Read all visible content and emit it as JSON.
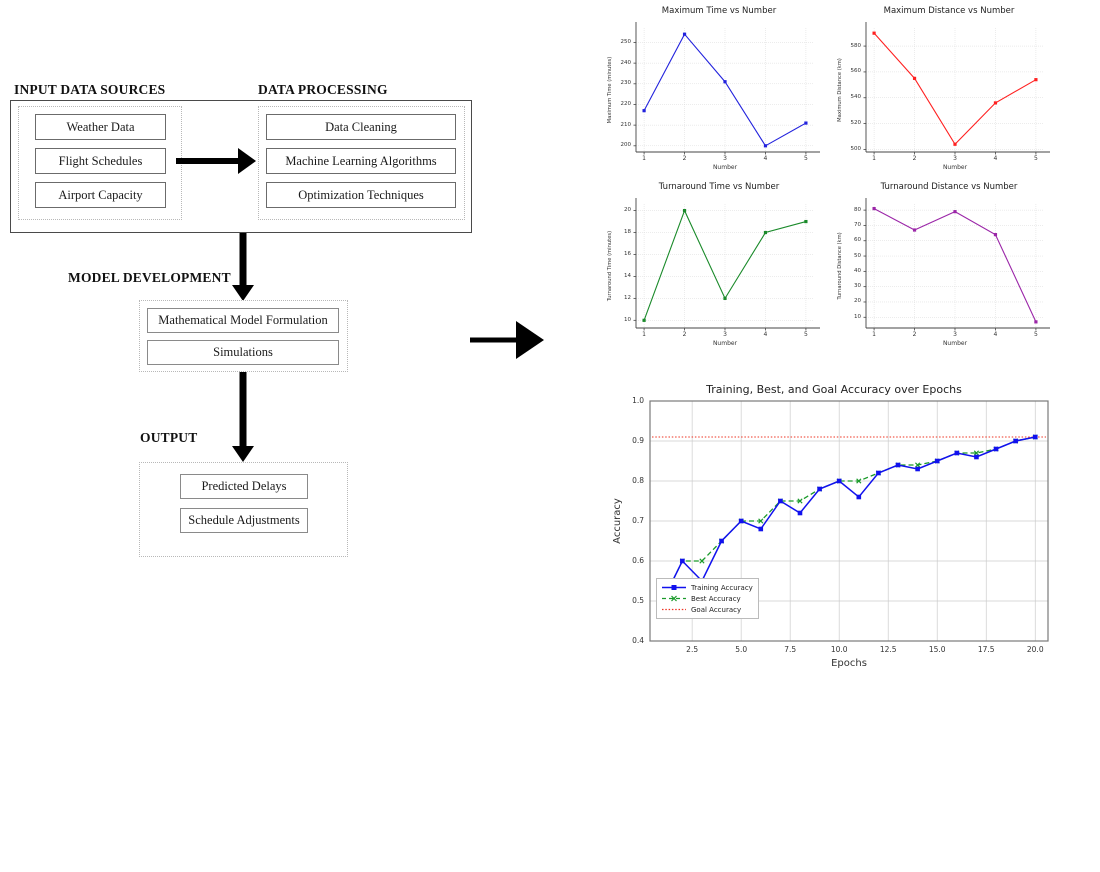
{
  "flowchart": {
    "headings": {
      "input": "INPUT DATA SOURCES",
      "processing": "DATA PROCESSING",
      "model": "MODEL DEVELOPMENT",
      "output": "OUTPUT"
    },
    "input_items": [
      "Weather Data",
      "Flight Schedules",
      "Airport Capacity"
    ],
    "processing_items": [
      "Data Cleaning",
      "Machine Learning Algorithms",
      "Optimization Techniques"
    ],
    "model_items": [
      "Mathematical Model Formulation",
      "Simulations"
    ],
    "output_items": [
      "Predicted Delays",
      "Schedule Adjustments"
    ]
  },
  "chart_data": [
    {
      "type": "line",
      "title": "Maximum Time vs Number",
      "xlabel": "Number",
      "ylabel": "Maximum Time (minutes)",
      "x": [
        1,
        2,
        3,
        4,
        5
      ],
      "values": [
        217,
        254,
        231,
        200,
        211
      ],
      "xticks": [
        "1",
        "2",
        "3",
        "4",
        "5"
      ],
      "yticks": [
        "200",
        "210",
        "220",
        "230",
        "240",
        "250"
      ],
      "xlim": [
        0.8,
        5.2
      ],
      "ylim": [
        197,
        257
      ],
      "color": "#2222dd",
      "grid": true,
      "legend": "none"
    },
    {
      "type": "line",
      "title": "Maximum Distance vs Number",
      "xlabel": "Number",
      "ylabel": "Maximum Distance (km)",
      "x": [
        1,
        2,
        3,
        4,
        5
      ],
      "values": [
        590,
        555,
        504,
        536,
        554
      ],
      "xticks": [
        "1",
        "2",
        "3",
        "4",
        "5"
      ],
      "yticks": [
        "500",
        "520",
        "540",
        "560",
        "580"
      ],
      "xlim": [
        0.8,
        5.2
      ],
      "ylim": [
        498,
        594
      ],
      "color": "#ff2020",
      "grid": true,
      "legend": "none"
    },
    {
      "type": "line",
      "title": "Turnaround Time vs Number",
      "xlabel": "Number",
      "ylabel": "Turnaround Time (minutes)",
      "x": [
        1,
        2,
        3,
        4,
        5
      ],
      "values": [
        10,
        20,
        12,
        18,
        19
      ],
      "xticks": [
        "1",
        "2",
        "3",
        "4",
        "5"
      ],
      "yticks": [
        "10",
        "12",
        "14",
        "16",
        "18",
        "20"
      ],
      "xlim": [
        0.8,
        5.2
      ],
      "ylim": [
        9.3,
        20.6
      ],
      "color": "#1a8a2a",
      "grid": true,
      "legend": "none"
    },
    {
      "type": "line",
      "title": "Turnaround Distance vs Number",
      "xlabel": "Number",
      "ylabel": "Turnaround Distance (km)",
      "x": [
        1,
        2,
        3,
        4,
        5
      ],
      "values": [
        81,
        67,
        79,
        64,
        7
      ],
      "xticks": [
        "1",
        "2",
        "3",
        "4",
        "5"
      ],
      "yticks": [
        "10",
        "20",
        "30",
        "40",
        "50",
        "60",
        "70",
        "80"
      ],
      "xlim": [
        0.8,
        5.2
      ],
      "ylim": [
        3,
        84
      ],
      "color": "#9b26a8",
      "grid": true,
      "legend": "none"
    },
    {
      "type": "line",
      "title": "Training, Best, and Goal Accuracy over Epochs",
      "xlabel": "Epochs",
      "ylabel": "Accuracy",
      "x": [
        1,
        2,
        3,
        4,
        5,
        6,
        7,
        8,
        9,
        10,
        11,
        12,
        13,
        14,
        15,
        16,
        17,
        18,
        19,
        20
      ],
      "series": [
        {
          "name": "Training Accuracy",
          "color": "#1111ee",
          "style": "solid-marker",
          "values": [
            0.5,
            0.6,
            0.55,
            0.65,
            0.7,
            0.68,
            0.75,
            0.72,
            0.78,
            0.8,
            0.76,
            0.82,
            0.84,
            0.83,
            0.85,
            0.87,
            0.86,
            0.88,
            0.9,
            0.91
          ]
        },
        {
          "name": "Best Accuracy",
          "color": "#1a9a2a",
          "style": "dashed-x",
          "values": [
            0.5,
            0.6,
            0.6,
            0.65,
            0.7,
            0.7,
            0.75,
            0.75,
            0.78,
            0.8,
            0.8,
            0.82,
            0.84,
            0.84,
            0.85,
            0.87,
            0.87,
            0.88,
            0.9,
            0.91
          ]
        },
        {
          "name": "Goal Accuracy",
          "color": "#ee3322",
          "style": "dotted-hline",
          "value": 0.91
        }
      ],
      "xticks": [
        "2.5",
        "5.0",
        "7.5",
        "10.0",
        "12.5",
        "15.0",
        "17.5",
        "20.0"
      ],
      "xtickvals": [
        2.5,
        5.0,
        7.5,
        10.0,
        12.5,
        15.0,
        17.5,
        20.0
      ],
      "yticks": [
        "0.4",
        "0.5",
        "0.6",
        "0.7",
        "0.8",
        "0.9",
        "1.0"
      ],
      "ytickvals": [
        0.4,
        0.5,
        0.6,
        0.7,
        0.8,
        0.9,
        1.0
      ],
      "xlim": [
        0.35,
        20.65
      ],
      "ylim": [
        0.4,
        1.0
      ],
      "grid": true,
      "legend": "lower left"
    }
  ]
}
